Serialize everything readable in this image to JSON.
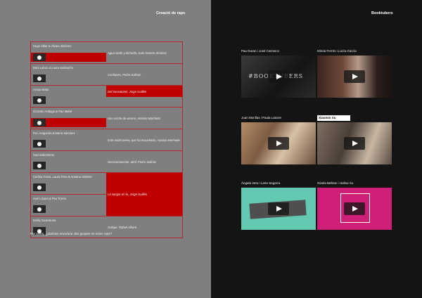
{
  "left_page": {
    "title": "Creació de raps",
    "rows": [
      {
        "authors": "Hugo Albar & Álvaro Jiménez",
        "poem": "Agua verde y dormido, Juan Ramón Jiménez",
        "red": true
      },
      {
        "authors": "Dani Lahoz & Laura Subirachs",
        "poem": "Confianza, Pedro Salinas",
        "red": false
      },
      {
        "authors": "Arnau Botia",
        "poem": "Del transatúnel, Jorge Guillén",
        "red": true
      },
      {
        "authors": "Gonzalo Ardiaga & Pau Mahé",
        "poem": "Una noche de verano, Antonio Machado",
        "red": true
      },
      {
        "authors": "Roc Aragonès & María Sánchez",
        "poem": "Este noble poeta, que ha escuchado, Antonio Machado",
        "red": false
      },
      {
        "authors": "Xavi Ballesteros",
        "poem": "Necesariamente, abril, Pedro Salinas",
        "red": false
      },
      {
        "authors": "Carlota Forns, Laura Tena & Ariadna Valiente",
        "poem": "La sangre al río, Jorge Guillén",
        "red": true
      },
      {
        "authors": "Axel Lizana & Pau Torres",
        "poem": "",
        "red": false
      },
      {
        "authors": "Kerlly Guanotuna",
        "poem": "Galope, Rafael Alberti",
        "red": false
      }
    ],
    "question": "Por cierto, ¿podríais encontrar dos guapos en estos raps?"
  },
  "right_page": {
    "title": "Booktubers",
    "videos": [
      {
        "label": "Pau Duran i José Carrasco",
        "thumb_text": "#BOOKTUBERS"
      },
      {
        "label": "Mireia Ferrés i Lucía García"
      },
      {
        "label": "Joan Morillas i Paula Latorre"
      },
      {
        "label": "Xiaomin Xu"
      },
      {
        "label": "Àngela Vera i Leire Segarra"
      },
      {
        "label": "Gisela Beltran i Huihui Xu"
      }
    ]
  }
}
